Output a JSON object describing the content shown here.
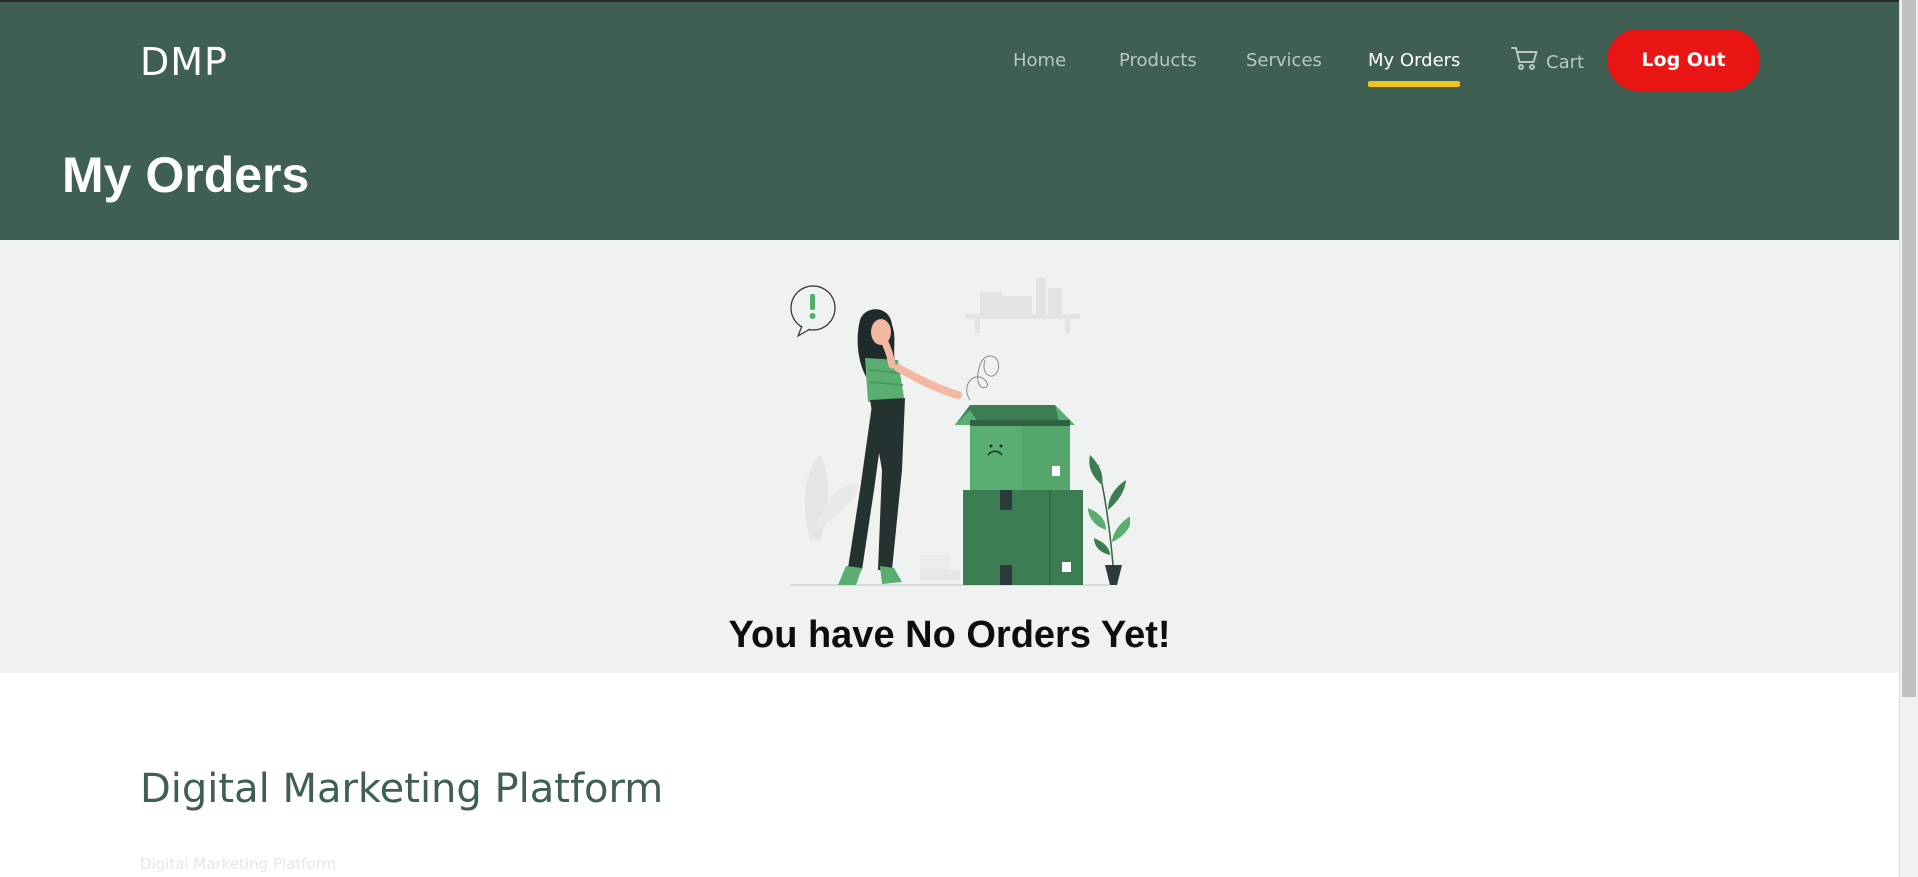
{
  "header": {
    "brand": "DMP",
    "page_title": "My Orders"
  },
  "nav": {
    "items": [
      {
        "label": "Home",
        "active": false
      },
      {
        "label": "Products",
        "active": false
      },
      {
        "label": "Services",
        "active": false
      },
      {
        "label": "My Orders",
        "active": true
      }
    ],
    "cart_label": "Cart",
    "logout_label": "Log Out"
  },
  "empty_state": {
    "message": "You have No Orders Yet!"
  },
  "footer": {
    "title": "Digital Marketing Platform",
    "subtitle": "Digital Marketing Platform"
  },
  "icons": {
    "cart": "cart-icon"
  },
  "colors": {
    "header_bg": "#3e5f51",
    "accent_underline": "#f2c31b",
    "logout_bg": "#ea1515",
    "empty_bg": "#f0f1f1",
    "box_green": "#5aae72",
    "box_dark_green": "#3c7c52"
  }
}
